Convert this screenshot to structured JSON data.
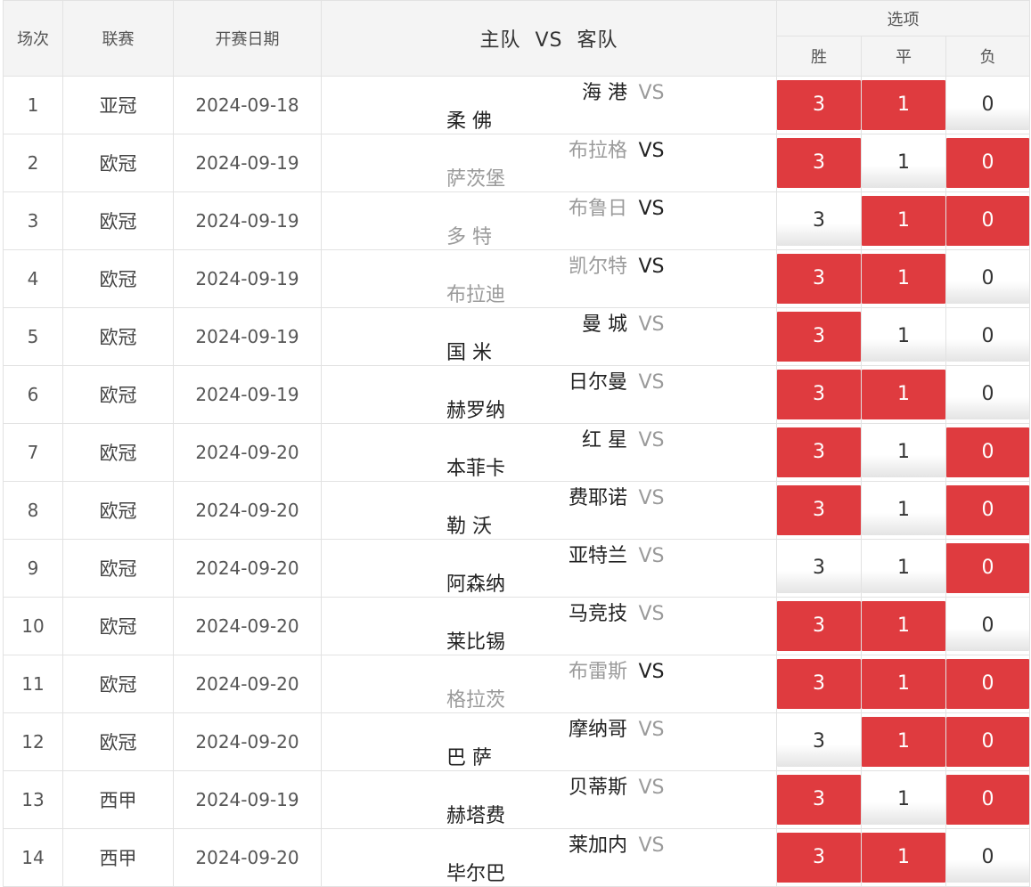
{
  "colors": {
    "selected": "#df3b3f",
    "header_bg": "#f4f4f4",
    "dim_team": "#9a9a9a"
  },
  "header": {
    "round": "场次",
    "league": "联赛",
    "date": "开赛日期",
    "home": "主队",
    "vs": "VS",
    "away": "客队",
    "options": "选项",
    "win": "胜",
    "draw": "平",
    "lose": "负"
  },
  "rows": [
    {
      "no": "1",
      "league": "亚冠",
      "date": "2024-09-18",
      "home": "海 港",
      "home_dim": false,
      "vs_dim": true,
      "away": "柔 佛",
      "away_dim": false,
      "options": [
        {
          "label": "3",
          "on": true
        },
        {
          "label": "1",
          "on": true
        },
        {
          "label": "0",
          "on": false
        }
      ]
    },
    {
      "no": "2",
      "league": "欧冠",
      "date": "2024-09-19",
      "home": "布拉格",
      "home_dim": true,
      "vs_dim": false,
      "away": "萨茨堡",
      "away_dim": true,
      "options": [
        {
          "label": "3",
          "on": true
        },
        {
          "label": "1",
          "on": false
        },
        {
          "label": "0",
          "on": true
        }
      ]
    },
    {
      "no": "3",
      "league": "欧冠",
      "date": "2024-09-19",
      "home": "布鲁日",
      "home_dim": true,
      "vs_dim": false,
      "away": "多 特",
      "away_dim": true,
      "options": [
        {
          "label": "3",
          "on": false
        },
        {
          "label": "1",
          "on": true
        },
        {
          "label": "0",
          "on": true
        }
      ]
    },
    {
      "no": "4",
      "league": "欧冠",
      "date": "2024-09-19",
      "home": "凯尔特",
      "home_dim": true,
      "vs_dim": false,
      "away": "布拉迪",
      "away_dim": true,
      "options": [
        {
          "label": "3",
          "on": true
        },
        {
          "label": "1",
          "on": true
        },
        {
          "label": "0",
          "on": false
        }
      ]
    },
    {
      "no": "5",
      "league": "欧冠",
      "date": "2024-09-19",
      "home": "曼 城",
      "home_dim": false,
      "vs_dim": true,
      "away": "国 米",
      "away_dim": false,
      "options": [
        {
          "label": "3",
          "on": true
        },
        {
          "label": "1",
          "on": false
        },
        {
          "label": "0",
          "on": false
        }
      ]
    },
    {
      "no": "6",
      "league": "欧冠",
      "date": "2024-09-19",
      "home": "日尔曼",
      "home_dim": false,
      "vs_dim": true,
      "away": "赫罗纳",
      "away_dim": false,
      "options": [
        {
          "label": "3",
          "on": true
        },
        {
          "label": "1",
          "on": true
        },
        {
          "label": "0",
          "on": false
        }
      ]
    },
    {
      "no": "7",
      "league": "欧冠",
      "date": "2024-09-20",
      "home": "红 星",
      "home_dim": false,
      "vs_dim": true,
      "away": "本菲卡",
      "away_dim": false,
      "options": [
        {
          "label": "3",
          "on": true
        },
        {
          "label": "1",
          "on": false
        },
        {
          "label": "0",
          "on": true
        }
      ]
    },
    {
      "no": "8",
      "league": "欧冠",
      "date": "2024-09-20",
      "home": "费耶诺",
      "home_dim": false,
      "vs_dim": true,
      "away": "勒 沃",
      "away_dim": false,
      "options": [
        {
          "label": "3",
          "on": true
        },
        {
          "label": "1",
          "on": false
        },
        {
          "label": "0",
          "on": true
        }
      ]
    },
    {
      "no": "9",
      "league": "欧冠",
      "date": "2024-09-20",
      "home": "亚特兰",
      "home_dim": false,
      "vs_dim": true,
      "away": "阿森纳",
      "away_dim": false,
      "options": [
        {
          "label": "3",
          "on": false
        },
        {
          "label": "1",
          "on": false
        },
        {
          "label": "0",
          "on": true
        }
      ]
    },
    {
      "no": "10",
      "league": "欧冠",
      "date": "2024-09-20",
      "home": "马竞技",
      "home_dim": false,
      "vs_dim": true,
      "away": "莱比锡",
      "away_dim": false,
      "options": [
        {
          "label": "3",
          "on": true
        },
        {
          "label": "1",
          "on": true
        },
        {
          "label": "0",
          "on": false
        }
      ]
    },
    {
      "no": "11",
      "league": "欧冠",
      "date": "2024-09-20",
      "home": "布雷斯",
      "home_dim": true,
      "vs_dim": false,
      "away": "格拉茨",
      "away_dim": true,
      "options": [
        {
          "label": "3",
          "on": true
        },
        {
          "label": "1",
          "on": true
        },
        {
          "label": "0",
          "on": true
        }
      ]
    },
    {
      "no": "12",
      "league": "欧冠",
      "date": "2024-09-20",
      "home": "摩纳哥",
      "home_dim": false,
      "vs_dim": true,
      "away": "巴 萨",
      "away_dim": false,
      "options": [
        {
          "label": "3",
          "on": false
        },
        {
          "label": "1",
          "on": true
        },
        {
          "label": "0",
          "on": true
        }
      ]
    },
    {
      "no": "13",
      "league": "西甲",
      "date": "2024-09-19",
      "home": "贝蒂斯",
      "home_dim": false,
      "vs_dim": true,
      "away": "赫塔费",
      "away_dim": false,
      "options": [
        {
          "label": "3",
          "on": true
        },
        {
          "label": "1",
          "on": false
        },
        {
          "label": "0",
          "on": true
        }
      ]
    },
    {
      "no": "14",
      "league": "西甲",
      "date": "2024-09-20",
      "home": "莱加内",
      "home_dim": false,
      "vs_dim": true,
      "away": "毕尔巴",
      "away_dim": false,
      "options": [
        {
          "label": "3",
          "on": true
        },
        {
          "label": "1",
          "on": true
        },
        {
          "label": "0",
          "on": false
        }
      ]
    }
  ]
}
